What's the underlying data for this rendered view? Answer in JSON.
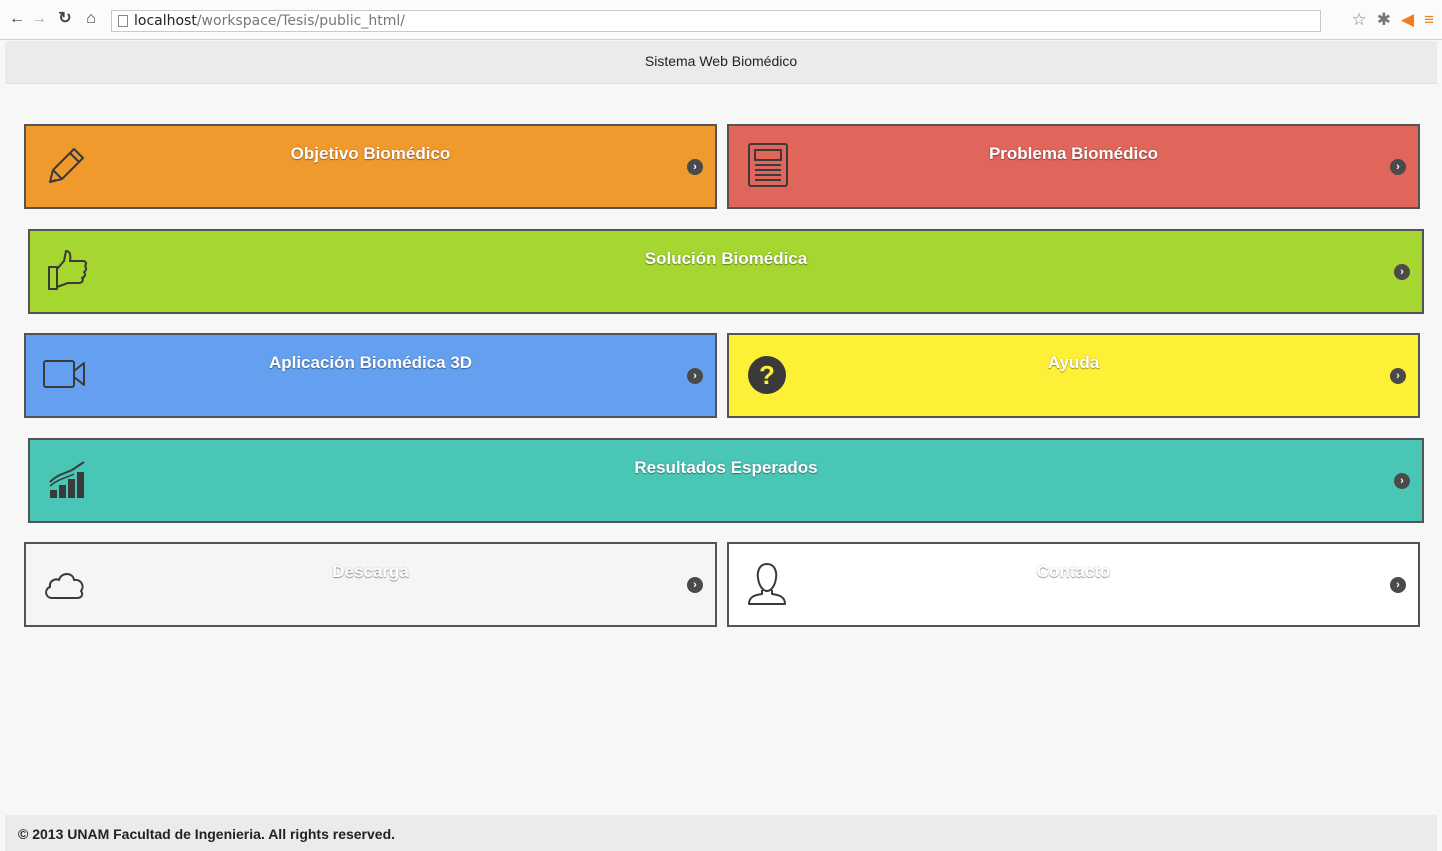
{
  "browser": {
    "url_host": "localhost",
    "url_path": "/workspace/Tesis/public_html/"
  },
  "header": {
    "title": "Sistema Web Biomédico"
  },
  "tiles": [
    {
      "label": "Objetivo Biomédico",
      "icon": "pencil-icon",
      "color": "#f09a2e"
    },
    {
      "label": "Problema Biomédico",
      "icon": "newspaper-icon",
      "color": "#e0655a"
    },
    {
      "label": "Solución Biomédica",
      "icon": "thumbs-up-icon",
      "color": "#a6d630"
    },
    {
      "label": "Aplicación Biomédica 3D",
      "icon": "video-camera-icon",
      "color": "#65a0f0"
    },
    {
      "label": "Ayuda",
      "icon": "question-icon",
      "color": "#fdf036"
    },
    {
      "label": "Resultados Esperados",
      "icon": "bar-chart-icon",
      "color": "#4ac6b6"
    },
    {
      "label": "Descarga",
      "icon": "cloud-icon",
      "color": "#f5f5f5"
    },
    {
      "label": "Contacto",
      "icon": "user-icon",
      "color": "#ffffff"
    }
  ],
  "footer": {
    "text": "© 2013 UNAM Facultad de Ingenieria. All rights reserved."
  }
}
